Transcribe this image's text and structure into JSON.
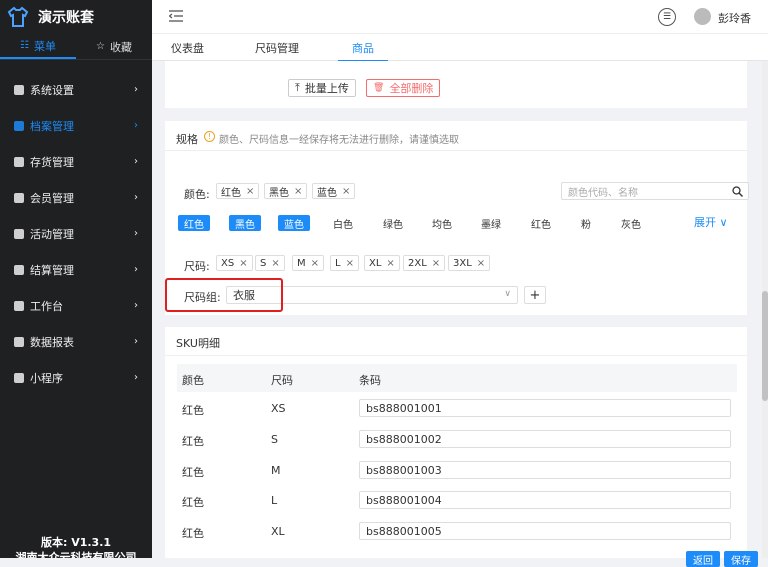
{
  "sidebar": {
    "brand": "演示账套",
    "tabs": [
      {
        "label": "菜单",
        "icon": "grid-icon"
      },
      {
        "label": "收藏",
        "icon": "star-icon"
      }
    ],
    "items": [
      {
        "label": "系统设置"
      },
      {
        "label": "档案管理",
        "active": true
      },
      {
        "label": "存货管理"
      },
      {
        "label": "会员管理"
      },
      {
        "label": "活动管理"
      },
      {
        "label": "结算管理"
      },
      {
        "label": "工作台"
      },
      {
        "label": "数据报表"
      },
      {
        "label": "小程序"
      }
    ],
    "chevron": "›",
    "version": "版本: V1.3.1",
    "company": "湖南大众云科技有限公司"
  },
  "topbar": {
    "user": "彭玲香",
    "menu_glyph": "☰"
  },
  "tabs": [
    "仪表盘",
    "尺码管理",
    "商品"
  ],
  "actions": {
    "upload": "批量上传",
    "upload_icon": "⤒",
    "delete": "全部删除",
    "delete_icon": "🗑"
  },
  "spec": {
    "title": "规格",
    "notice": "颜色、尺码信息一经保存将无法进行删除，请谨慎选取",
    "color_label": "颜色:",
    "color_tags": [
      "红色",
      "黑色",
      "蓝色"
    ],
    "search_placeholder": "颜色代码、名称",
    "color_options": [
      {
        "label": "红色",
        "selected": true
      },
      {
        "label": "黑色",
        "selected": true
      },
      {
        "label": "蓝色",
        "selected": true
      },
      {
        "label": "白色"
      },
      {
        "label": "绿色"
      },
      {
        "label": "均色"
      },
      {
        "label": "墨绿"
      },
      {
        "label": "红色"
      },
      {
        "label": "粉"
      },
      {
        "label": "灰色"
      }
    ],
    "expand": "展开 ∨",
    "size_label": "尺码:",
    "size_tags": [
      "XS",
      "S",
      "M",
      "L",
      "XL",
      "2XL",
      "3XL"
    ],
    "size_group_label": "尺码组:",
    "size_group_value": "衣服",
    "add_glyph": "+"
  },
  "sku": {
    "title": "SKU明细",
    "headers": [
      "颜色",
      "尺码",
      "条码"
    ],
    "rows": [
      {
        "color": "红色",
        "size": "XS",
        "barcode": "bs888001001"
      },
      {
        "color": "红色",
        "size": "S",
        "barcode": "bs888001002"
      },
      {
        "color": "红色",
        "size": "M",
        "barcode": "bs888001003"
      },
      {
        "color": "红色",
        "size": "L",
        "barcode": "bs888001004"
      },
      {
        "color": "红色",
        "size": "XL",
        "barcode": "bs888001005"
      }
    ]
  },
  "footer_buttons": [
    "返回",
    "保存"
  ],
  "colors": {
    "accent": "#1d8cf8",
    "danger": "#f56c6c",
    "sidebar_bg": "#1f2022",
    "highlight": "#e02020"
  }
}
